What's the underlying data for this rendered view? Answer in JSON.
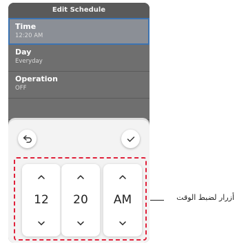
{
  "screen": {
    "title": "Edit Schedule"
  },
  "menu": [
    {
      "label": "Time",
      "value": "12:20 AM",
      "selected": true
    },
    {
      "label": "Day",
      "value": "Everyday",
      "selected": false
    },
    {
      "label": "Operation",
      "value": "OFF",
      "selected": false
    }
  ],
  "picker": {
    "hour": "12",
    "minute": "20",
    "ampm": "AM"
  },
  "icons": {
    "back": "back-arrow-icon",
    "confirm": "check-icon",
    "up": "chevron-up-icon",
    "down": "chevron-down-icon"
  },
  "colors": {
    "highlight_border": "#e0203a",
    "selected_border": "#3c73b2"
  },
  "annotation": {
    "text": "أزرار لضبط الوقت"
  }
}
